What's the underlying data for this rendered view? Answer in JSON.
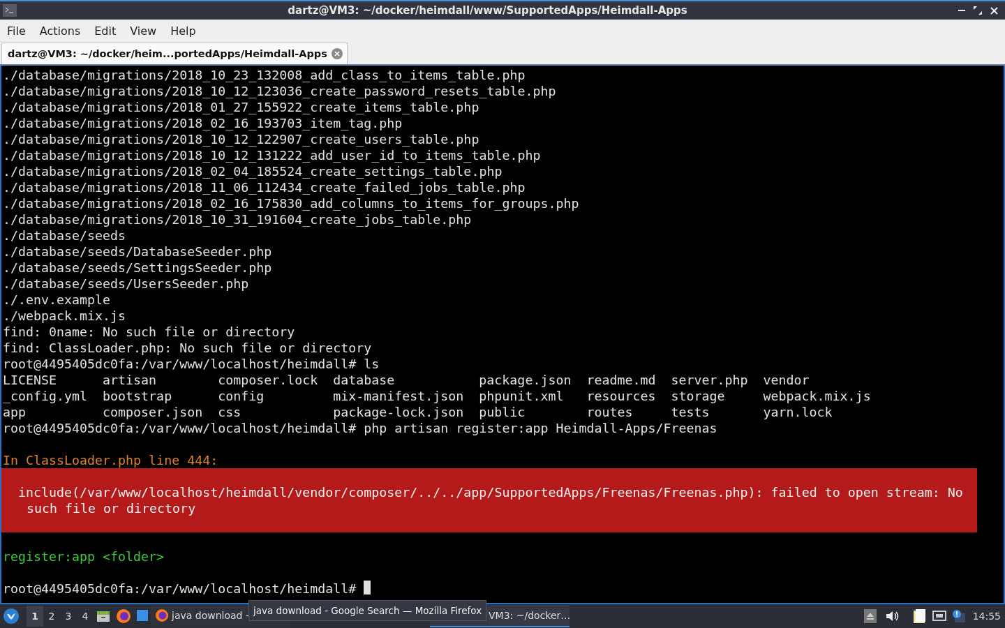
{
  "window": {
    "title": "dartz@VM3: ~/docker/heimdall/www/SupportedApps/Heimdall-Apps"
  },
  "menu": [
    "File",
    "Actions",
    "Edit",
    "View",
    "Help"
  ],
  "tabs": [
    {
      "label": "dartz@VM3: ~/docker/heim...portedApps/Heimdall-Apps",
      "selected": true
    }
  ],
  "terminal": [
    {
      "kind": "text",
      "text": "./database/migrations/2018_10_23_132008_add_class_to_items_table.php"
    },
    {
      "kind": "text",
      "text": "./database/migrations/2018_10_12_123036_create_password_resets_table.php"
    },
    {
      "kind": "text",
      "text": "./database/migrations/2018_01_27_155922_create_items_table.php"
    },
    {
      "kind": "text",
      "text": "./database/migrations/2018_02_16_193703_item_tag.php"
    },
    {
      "kind": "text",
      "text": "./database/migrations/2018_10_12_122907_create_users_table.php"
    },
    {
      "kind": "text",
      "text": "./database/migrations/2018_10_12_131222_add_user_id_to_items_table.php"
    },
    {
      "kind": "text",
      "text": "./database/migrations/2018_02_04_185524_create_settings_table.php"
    },
    {
      "kind": "text",
      "text": "./database/migrations/2018_11_06_112434_create_failed_jobs_table.php"
    },
    {
      "kind": "text",
      "text": "./database/migrations/2018_02_16_175830_add_columns_to_items_for_groups.php"
    },
    {
      "kind": "text",
      "text": "./database/migrations/2018_10_31_191604_create_jobs_table.php"
    },
    {
      "kind": "text",
      "text": "./database/seeds"
    },
    {
      "kind": "text",
      "text": "./database/seeds/DatabaseSeeder.php"
    },
    {
      "kind": "text",
      "text": "./database/seeds/SettingsSeeder.php"
    },
    {
      "kind": "text",
      "text": "./database/seeds/UsersSeeder.php"
    },
    {
      "kind": "text",
      "text": "./.env.example"
    },
    {
      "kind": "text",
      "text": "./webpack.mix.js"
    },
    {
      "kind": "text",
      "text": "find: 0name: No such file or directory"
    },
    {
      "kind": "text",
      "text": "find: ClassLoader.php: No such file or directory"
    },
    {
      "kind": "text",
      "text": "root@4495405dc0fa:/var/www/localhost/heimdall# ls"
    },
    {
      "kind": "ls",
      "cells": [
        "LICENSE",
        "artisan",
        "composer.lock",
        "database",
        "package.json",
        "readme.md",
        "server.php",
        "vendor"
      ]
    },
    {
      "kind": "ls",
      "cells": [
        "_config.yml",
        "bootstrap",
        "config",
        "mix-manifest.json",
        "phpunit.xml",
        "resources",
        "storage",
        "webpack.mix.js"
      ]
    },
    {
      "kind": "ls",
      "cells": [
        "app",
        "composer.json",
        "css",
        "package-lock.json",
        "public",
        "routes",
        "tests",
        "yarn.lock"
      ]
    },
    {
      "kind": "text",
      "text": "root@4495405dc0fa:/var/www/localhost/heimdall# php artisan register:app Heimdall-Apps/Freenas"
    },
    {
      "kind": "blank"
    },
    {
      "kind": "warning",
      "text": "In ClassLoader.php line 444:"
    },
    {
      "kind": "error",
      "lines": [
        "include(/var/www/localhost/heimdall/vendor/composer/../../app/SupportedApps/Freenas/Freenas.php): failed to open stream: No",
        "such file or directory"
      ]
    },
    {
      "kind": "blank"
    },
    {
      "kind": "usage",
      "text": "register:app <folder>"
    },
    {
      "kind": "blank"
    },
    {
      "kind": "prompt",
      "text": "root@4495405dc0fa:/var/www/localhost/heimdall#"
    }
  ],
  "taskbar": {
    "workspaces": [
      {
        "label": "1",
        "selected": true
      },
      {
        "label": "2",
        "selected": false
      },
      {
        "label": "3",
        "selected": false
      },
      {
        "label": "4",
        "selected": false
      }
    ],
    "tasks": [
      {
        "label": "java download -",
        "active": false
      },
      {
        "label": "VM3: ~/docker…",
        "active": true
      }
    ],
    "tooltip": "java download - Google Search — Mozilla Firefox",
    "clock": "14:55"
  }
}
